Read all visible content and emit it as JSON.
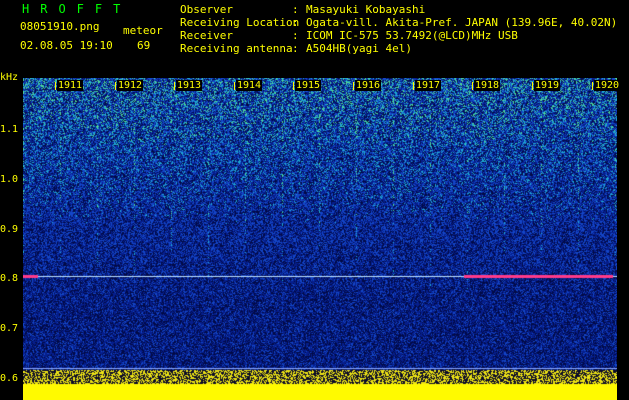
{
  "header": {
    "app_title": "HROFFT",
    "file_name": "08051910.png",
    "timestamp": "02.08.05 19:10",
    "meteor_label": "meteor",
    "meteor_count": "69",
    "info": [
      {
        "key": "Observer",
        "value": "Masayuki Kobayashi"
      },
      {
        "key": "Receiving Location",
        "value": "Ogata-vill. Akita-Pref. JAPAN (139.96E, 40.02N)"
      },
      {
        "key": "Receiver",
        "value": "ICOM IC-575 53.7492(@LCD)MHz USB"
      },
      {
        "key": "Receiving antenna",
        "value": "A504HB(yagi 4el)"
      }
    ],
    "separator": ":"
  },
  "axis": {
    "unit": "kHz",
    "y_ticks": [
      "1.1",
      "1.0",
      "0.9",
      "0.8",
      "0.7",
      "0.6"
    ],
    "hours": [
      "1911",
      "1912",
      "1913",
      "1914",
      "1915",
      "1916",
      "1917",
      "1918",
      "1919",
      "1920"
    ]
  },
  "colors": {
    "text": "#ffff00",
    "title": "#00ff00",
    "background": "#000000",
    "noise_dark": "#02136b",
    "noise_mid": "#1744c9",
    "noise_bright": "#2fb6d8",
    "noise_hot": "#7ef0a0",
    "echo_line": "#ff3a8a"
  }
}
